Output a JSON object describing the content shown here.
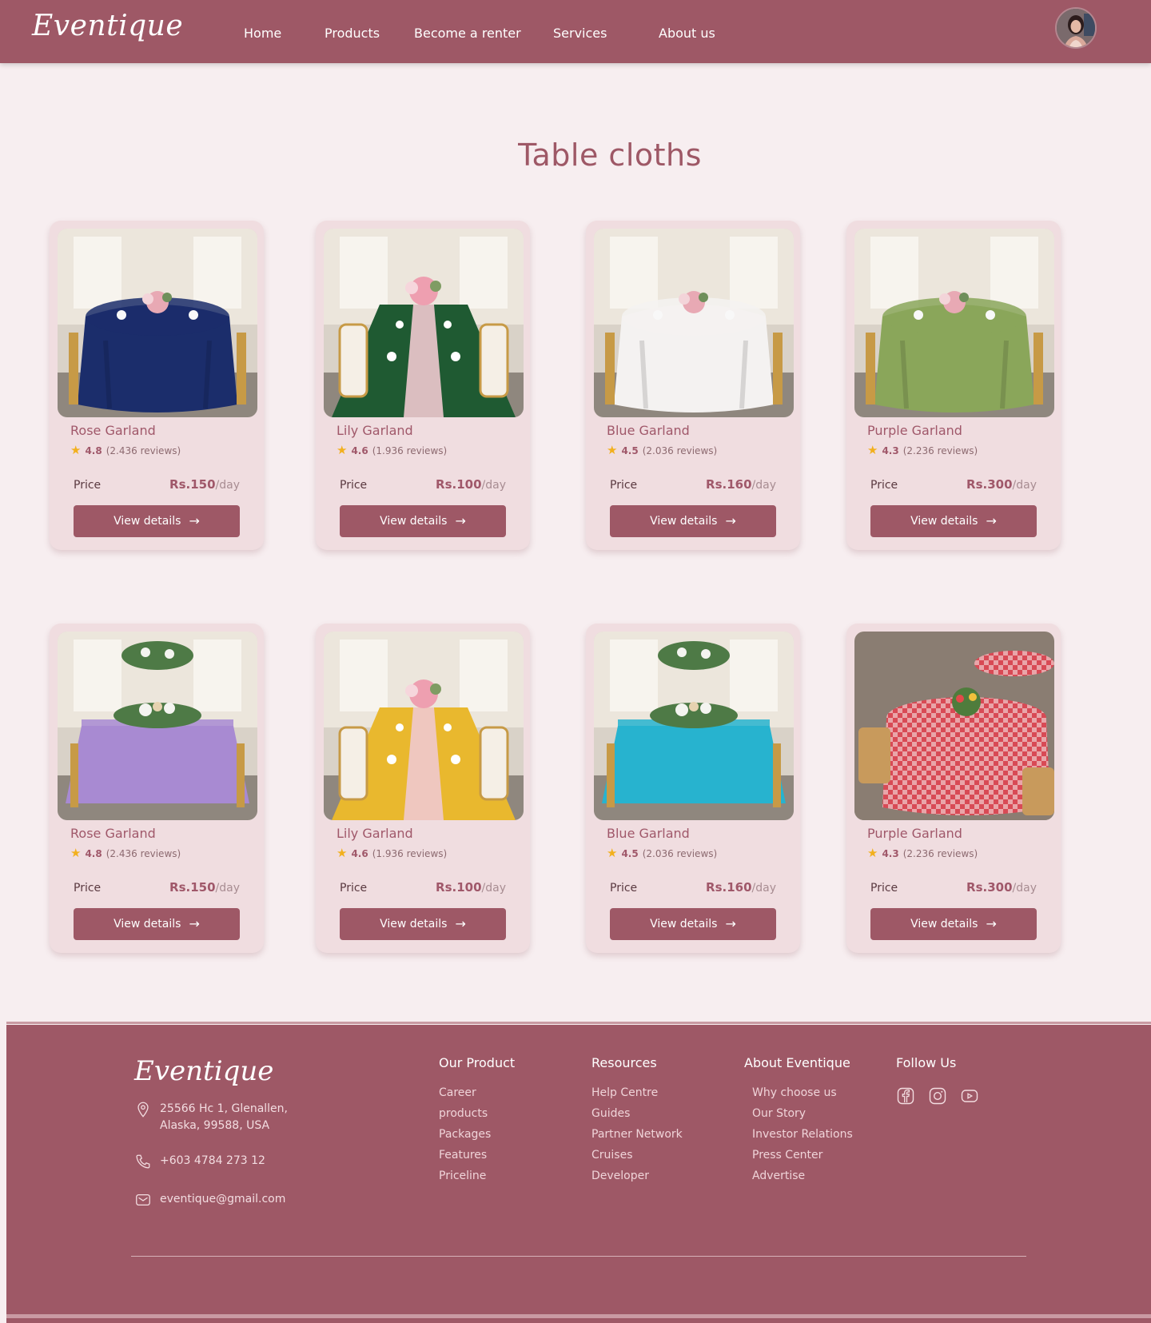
{
  "brand": {
    "name": "Eventique"
  },
  "nav": {
    "items": [
      "Home",
      "Products",
      "Become a renter",
      "Services",
      "About us"
    ]
  },
  "page": {
    "title": "Table cloths"
  },
  "colors": {
    "primary": "#9e5866",
    "background": "#f7eef0",
    "card": "#f0dde0",
    "star": "#f2b01e"
  },
  "common": {
    "price_label": "Price",
    "view_details": "View details",
    "per_day": "/day"
  },
  "products": [
    {
      "name": "Rose Garland",
      "rating": "4.8",
      "reviews": "(2.436 reviews)",
      "price": "Rs.150",
      "cloth": "#1b2d6b",
      "scene": "round"
    },
    {
      "name": "Lily Garland",
      "rating": "4.6",
      "reviews": "(1.936 reviews)",
      "price": "Rs.100",
      "cloth": "#1f5a32",
      "scene": "long"
    },
    {
      "name": "Blue Garland",
      "rating": "4.5",
      "reviews": "(2.036 reviews)",
      "price": "Rs.160",
      "cloth": "#f4f2f1",
      "scene": "round"
    },
    {
      "name": "Purple Garland",
      "rating": "4.3",
      "reviews": "(2.236 reviews)",
      "price": "Rs.300",
      "cloth": "#8aa65a",
      "scene": "round"
    },
    {
      "name": "Rose Garland",
      "rating": "4.8",
      "reviews": "(2.436 reviews)",
      "price": "Rs.150",
      "cloth": "#a88ad2",
      "scene": "rect"
    },
    {
      "name": "Lily Garland",
      "rating": "4.6",
      "reviews": "(1.936 reviews)",
      "price": "Rs.100",
      "cloth": "#e9b82e",
      "scene": "long"
    },
    {
      "name": "Blue Garland",
      "rating": "4.5",
      "reviews": "(2.036 reviews)",
      "price": "Rs.160",
      "cloth": "#27b3cf",
      "scene": "rect"
    },
    {
      "name": "Purple Garland",
      "rating": "4.3",
      "reviews": "(2.236 reviews)",
      "price": "Rs.300",
      "cloth": "#d84a55",
      "scene": "check"
    }
  ],
  "footer": {
    "address": "25566 Hc 1, Glenallen,\nAlaska, 99588, USA",
    "phone": "+603 4784 273 12",
    "email": "eventique@gmail.com",
    "columns": [
      {
        "heading": "Our Product",
        "links": [
          "Career",
          "products",
          "Packages",
          "Features",
          "Priceline"
        ]
      },
      {
        "heading": "Resources",
        "links": [
          "Help Centre",
          "Guides",
          "Partner Network",
          "Cruises",
          "Developer"
        ]
      },
      {
        "heading": "About Eventique",
        "links": [
          "Why choose us",
          "Our Story",
          "Investor Relations",
          "Press Center",
          "Advertise"
        ]
      }
    ],
    "follow_heading": "Follow Us",
    "social": [
      "facebook-icon",
      "instagram-icon",
      "youtube-icon"
    ]
  }
}
